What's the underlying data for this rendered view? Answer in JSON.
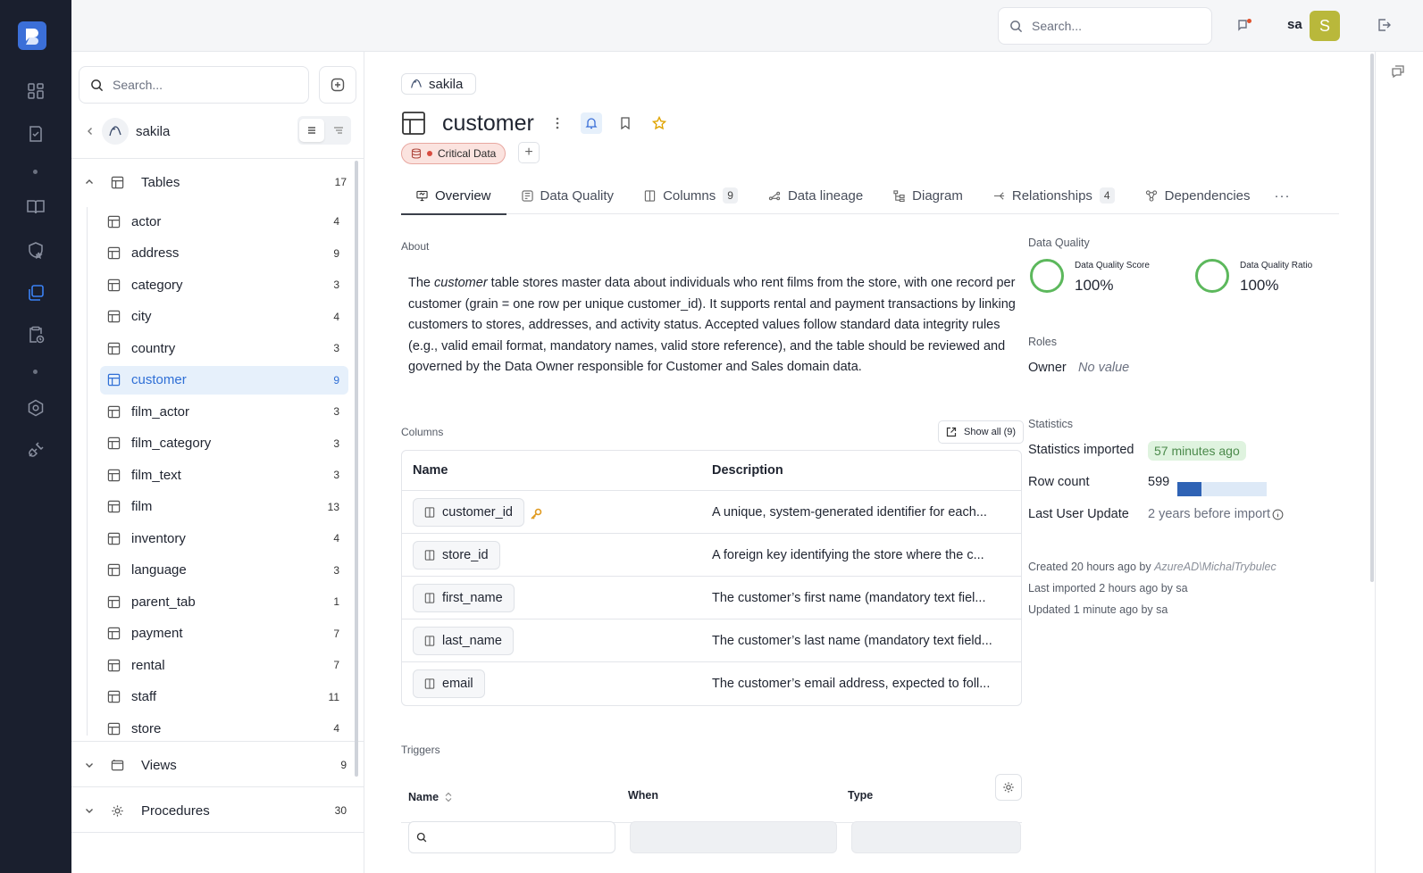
{
  "topbar": {
    "search_placeholder": "Search...",
    "user": "sa",
    "avatar_letter": "S"
  },
  "sidebar": {
    "search_placeholder": "Search...",
    "database": "sakila",
    "groups": [
      {
        "label": "Tables",
        "count": "17"
      },
      {
        "label": "Views",
        "count": "9"
      },
      {
        "label": "Procedures",
        "count": "30"
      }
    ],
    "tables": [
      {
        "name": "actor",
        "count": "4"
      },
      {
        "name": "address",
        "count": "9"
      },
      {
        "name": "category",
        "count": "3"
      },
      {
        "name": "city",
        "count": "4"
      },
      {
        "name": "country",
        "count": "3"
      },
      {
        "name": "customer",
        "count": "9"
      },
      {
        "name": "film_actor",
        "count": "3"
      },
      {
        "name": "film_category",
        "count": "3"
      },
      {
        "name": "film_text",
        "count": "3"
      },
      {
        "name": "film",
        "count": "13"
      },
      {
        "name": "inventory",
        "count": "4"
      },
      {
        "name": "language",
        "count": "3"
      },
      {
        "name": "parent_tab",
        "count": "1"
      },
      {
        "name": "payment",
        "count": "7"
      },
      {
        "name": "rental",
        "count": "7"
      },
      {
        "name": "staff",
        "count": "11"
      },
      {
        "name": "store",
        "count": "4"
      }
    ]
  },
  "main": {
    "breadcrumb": "sakila",
    "title": "customer",
    "tag": "Critical Data",
    "tabs": [
      {
        "label": "Overview",
        "badge": ""
      },
      {
        "label": "Data Quality",
        "badge": ""
      },
      {
        "label": "Columns",
        "badge": "9"
      },
      {
        "label": "Data lineage",
        "badge": ""
      },
      {
        "label": "Diagram",
        "badge": ""
      },
      {
        "label": "Relationships",
        "badge": "4"
      },
      {
        "label": "Dependencies",
        "badge": ""
      }
    ],
    "about_label": "About",
    "about": {
      "p1": "The ",
      "em": "customer",
      "p2": " table stores master data about individuals who rent films from the store, with one record per customer (grain = one row per unique customer_id). It supports rental and payment transactions by linking customers to stores, addresses, and activity status. Accepted values follow standard data integrity rules (e.g., valid email format, mandatory names, valid store reference), and the table should be reviewed and governed by the Data Owner responsible for Customer and Sales domain data."
    },
    "columns_label": "Columns",
    "show_all": "Show all (9)",
    "columns_headers": {
      "name": "Name",
      "description": "Description"
    },
    "columns": [
      {
        "name": "customer_id",
        "description": "A unique, system-generated identifier for each...",
        "key": true
      },
      {
        "name": "store_id",
        "description": "A foreign key identifying the store where the c..."
      },
      {
        "name": "first_name",
        "description": "The customer’s first name (mandatory text fiel..."
      },
      {
        "name": "last_name",
        "description": "The customer’s last name (mandatory text field..."
      },
      {
        "name": "email",
        "description": "The customer’s email address, expected to foll..."
      }
    ],
    "triggers_label": "Triggers",
    "triggers_headers": {
      "name": "Name",
      "when": "When",
      "type": "Type"
    }
  },
  "right": {
    "dq_label": "Data Quality",
    "dq_score_label": "Data Quality Score",
    "dq_score": "100%",
    "dq_ratio_label": "Data Quality Ratio",
    "dq_ratio": "100%",
    "roles_label": "Roles",
    "owner_label": "Owner",
    "owner_value": "No value",
    "stats_label": "Statistics",
    "stats_imported_label": "Statistics imported",
    "stats_imported_value": "57 minutes ago",
    "row_count_label": "Row count",
    "row_count": "599",
    "row_count_fill": 0.27,
    "last_update_label": "Last User Update",
    "last_update_value": "2 years before import",
    "created": "Created 20 hours ago by ",
    "created_by": "AzureAD\\MichalTrybulec",
    "imported": "Last imported 2 hours ago by sa",
    "updated": "Updated 1 minute ago by sa"
  },
  "colors": {
    "accent": "#2f6fd6",
    "rail": "#1a1f2e",
    "critical": "#d84b3f",
    "dq_ring": "#5cb85c"
  }
}
